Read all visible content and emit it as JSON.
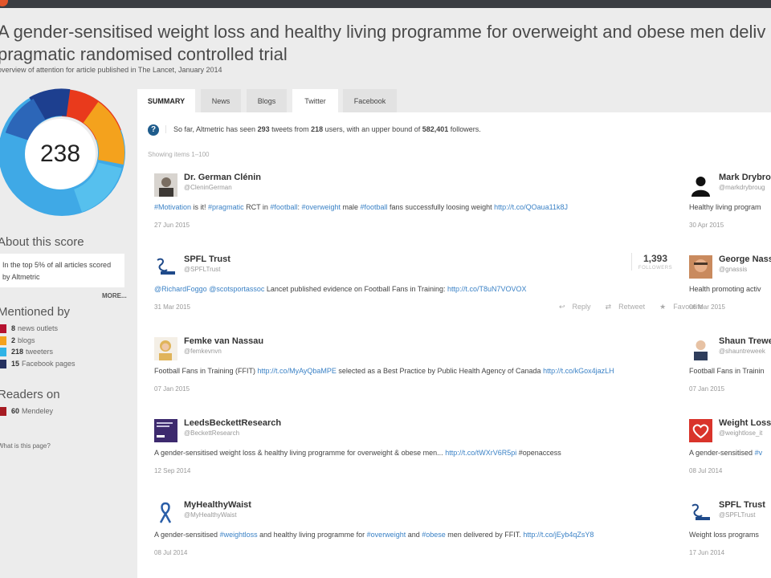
{
  "title_line1": "A gender-sensitised weight loss and healthy living programme for overweight and obese men deliv",
  "title_line2": "pragmatic randomised controlled trial",
  "subtitle": "overview of attention for article published in The Lancet, January 2014",
  "score": "238",
  "about_heading": "About this score",
  "score_text_line1": "In the top 5% of all articles scored",
  "score_text_line2": "by Altmetric",
  "more": "MORE...",
  "mentioned_heading": "Mentioned by",
  "mentions": [
    {
      "count": "8",
      "label": "news outlets",
      "color": "#b5122f"
    },
    {
      "count": "2",
      "label": "blogs",
      "color": "#f4a21d"
    },
    {
      "count": "218",
      "label": "tweeters",
      "color": "#2fb3e6"
    },
    {
      "count": "15",
      "label": "Facebook pages",
      "color": "#25315f"
    }
  ],
  "readers_heading": "Readers on",
  "readers": [
    {
      "count": "60",
      "label": "Mendeley",
      "color": "#a61b22"
    }
  ],
  "what_is": "What is this page?",
  "tabs": [
    "SUMMARY",
    "News",
    "Blogs",
    "Twitter",
    "Facebook"
  ],
  "info": {
    "pre": "So far, Altmetric has seen ",
    "tweets": "293",
    "mid1": " tweets from ",
    "users": "218",
    "mid2": " users, with an upper bound of ",
    "followers": "582,401",
    "post": " followers."
  },
  "showing": "Showing items 1–100",
  "followers_count": "1,393",
  "followers_label": "FOLLOWERS",
  "actions": {
    "reply": "Reply",
    "retweet": "Retweet",
    "favourite": "Favourite"
  },
  "tweets_left": [
    {
      "name": "Dr. German Clénin",
      "handle": "@CleninGerman",
      "date": "27 Jun 2015",
      "parts": [
        [
          "#Motivation",
          true
        ],
        [
          " is it! ",
          false
        ],
        [
          "#pragmatic",
          true
        ],
        [
          " RCT in ",
          false
        ],
        [
          "#football",
          true
        ],
        [
          ": ",
          false
        ],
        [
          "#overweight",
          true
        ],
        [
          " male ",
          false
        ],
        [
          "#football",
          true
        ],
        [
          " fans successfully loosing weight ",
          false
        ],
        [
          "http://t.co/QOaua11k8J",
          true
        ]
      ]
    },
    {
      "name": "SPFL Trust",
      "handle": "@SPFLTrust",
      "date": "31 Mar 2015",
      "parts": [
        [
          "@RichardFoggo",
          true
        ],
        [
          " ",
          false
        ],
        [
          "@scotsportassoc",
          true
        ],
        [
          " Lancet published evidence on Football Fans in Training: ",
          false
        ],
        [
          "http://t.co/T8uN7VOVOX",
          true
        ]
      ]
    },
    {
      "name": "Femke van Nassau",
      "handle": "@femkevnvn",
      "date": "07 Jan 2015",
      "parts": [
        [
          "Football Fans in Training (FFIT) ",
          false
        ],
        [
          "http://t.co/MyAyQbaMPE",
          true
        ],
        [
          " selected as a Best Practice by Public Health Agency of Canada ",
          false
        ],
        [
          "http://t.co/kGox4jazLH",
          true
        ]
      ]
    },
    {
      "name": "LeedsBeckettResearch",
      "handle": "@BeckettResearch",
      "date": "12 Sep 2014",
      "parts": [
        [
          "A gender-sensitised weight loss & healthy living programme for overweight & obese men... ",
          false
        ],
        [
          "http://t.co/tWXrV6R5pi",
          true
        ],
        [
          " #openaccess",
          false
        ]
      ]
    },
    {
      "name": "MyHealthyWaist",
      "handle": "@MyHealthyWaist",
      "date": "08 Jul 2014",
      "parts": [
        [
          "A gender-sensitised ",
          false
        ],
        [
          "#weightloss",
          true
        ],
        [
          " and healthy living programme for ",
          false
        ],
        [
          "#overweight",
          true
        ],
        [
          " and ",
          false
        ],
        [
          "#obese",
          true
        ],
        [
          " men delivered by FFIT. ",
          false
        ],
        [
          "http://t.co/jEyb4qZsY8",
          true
        ]
      ]
    }
  ],
  "tweets_right": [
    {
      "name": "Mark Drybro",
      "handle": "@markdrybroug",
      "date": "30 Apr 2015",
      "parts": [
        [
          "Healthy living program",
          false
        ]
      ]
    },
    {
      "name": "George Nass",
      "handle": "@gnassis",
      "date": "06 Mar 2015",
      "parts": [
        [
          "Health promoting activ",
          false
        ]
      ]
    },
    {
      "name": "Shaun Trewe",
      "handle": "@shauntreweek",
      "date": "07 Jan 2015",
      "parts": [
        [
          "Football Fans in Trainin",
          false
        ]
      ]
    },
    {
      "name": "Weight Loss",
      "handle": "@weightlose_it",
      "date": "08 Jul 2014",
      "parts": [
        [
          "A gender-sensitised ",
          false
        ],
        [
          "#v",
          true
        ]
      ]
    },
    {
      "name": "SPFL Trust",
      "handle": "@SPFLTrust",
      "date": "17 Jun 2014",
      "parts": [
        [
          "Weight loss programs",
          false
        ]
      ]
    }
  ]
}
